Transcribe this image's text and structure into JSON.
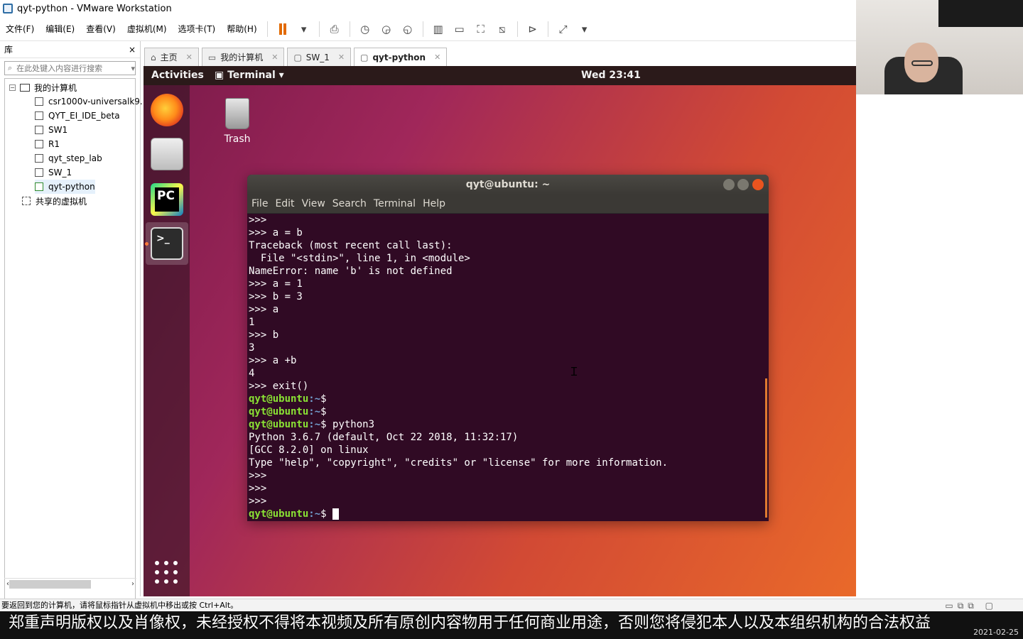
{
  "window": {
    "title": "qyt-python - VMware Workstation"
  },
  "menubar": {
    "items": [
      "文件(F)",
      "编辑(E)",
      "查看(V)",
      "虚拟机(M)",
      "选项卡(T)",
      "帮助(H)"
    ]
  },
  "library": {
    "title": "库",
    "close": "×",
    "search_placeholder": "在此处键入内容进行搜索",
    "tree": {
      "root": "我的计算机",
      "vms": [
        "csr1000v-universalk9.",
        "QYT_EI_IDE_beta",
        "SW1",
        "R1",
        "qyt_step_lab",
        "SW_1",
        "qyt-python"
      ],
      "shared": "共享的虚拟机"
    }
  },
  "tabs": [
    {
      "label": "主页"
    },
    {
      "label": "我的计算机"
    },
    {
      "label": "SW_1"
    },
    {
      "label": "qyt-python"
    }
  ],
  "ubuntu": {
    "activities": "Activities",
    "app_menu": "Terminal ▾",
    "clock": "Wed 23:41",
    "trash_label": "Trash",
    "pycharm_label": "PC"
  },
  "terminal": {
    "title": "qyt@ubuntu: ~",
    "menu": [
      "File",
      "Edit",
      "View",
      "Search",
      "Terminal",
      "Help"
    ],
    "prompt_user": "qyt@ubuntu",
    "prompt_path": ":~",
    "prompt_symbol": "$",
    "lines": [
      ">>>",
      ">>> a = b",
      "Traceback (most recent call last):",
      "  File \"<stdin>\", line 1, in <module>",
      "NameError: name 'b' is not defined",
      ">>> a = 1",
      ">>> b = 3",
      ">>> a",
      "1",
      ">>> b",
      "3",
      ">>> a +b",
      "4",
      ">>> exit()"
    ],
    "prompt_cmd1": "",
    "prompt_cmd2": "",
    "prompt_cmd3": " python3",
    "lines2": [
      "Python 3.6.7 (default, Oct 22 2018, 11:32:17)",
      "[GCC 8.2.0] on linux",
      "Type \"help\", \"copyright\", \"credits\" or \"license\" for more information.",
      ">>>",
      ">>>",
      ">>>"
    ]
  },
  "status": {
    "message": "要返回到您的计算机，请将鼠标指针从虚拟机中移出或按 Ctrl+Alt。"
  },
  "subtitle": "郑重声明版权以及肖像权，未经授权不得将本视频及所有原创内容物用于任何商业用途，否则您将侵犯本人以及本组织机构的合法权益",
  "date": "2021-02-25"
}
